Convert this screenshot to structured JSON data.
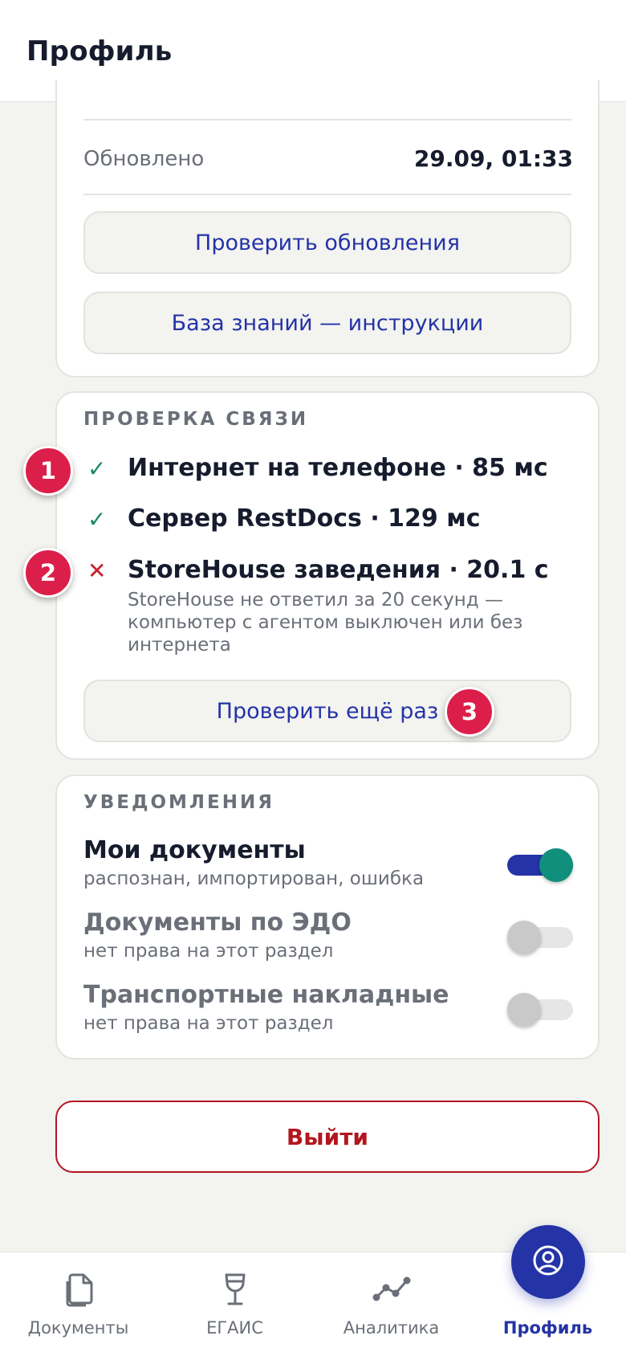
{
  "header": {
    "title": "Профиль"
  },
  "app_info": {
    "updated_label": "Обновлено",
    "updated_value": "29.09, 01:33",
    "check_updates_label": "Проверить обновления",
    "knowledge_base_label": "База знаний — инструкции"
  },
  "connection": {
    "title": "ПРОВЕРКА СВЯЗИ",
    "checks": [
      {
        "status": "ok",
        "mark": "✓",
        "title": "Интернет на телефоне · 85 мс"
      },
      {
        "status": "ok",
        "mark": "✓",
        "title": "Сервер RestDocs · 129 мс"
      },
      {
        "status": "fail",
        "mark": "✕",
        "title": "StoreHouse заведения · 20.1 с",
        "description": "StoreHouse не ответил за 20 секунд — компьютер с агентом выключен или без интернета"
      }
    ],
    "retry_label": "Проверить ещё раз"
  },
  "notifications": {
    "title": "УВЕДОМЛЕНИЯ",
    "items": [
      {
        "title": "Мои документы",
        "subtitle": "распознан, импортирован, ошибка",
        "enabled": true
      },
      {
        "title": "Документы по ЭДО",
        "subtitle": "нет права на этот раздел",
        "enabled": false
      },
      {
        "title": "Транспортные накладные",
        "subtitle": "нет права на этот раздел",
        "enabled": false
      }
    ]
  },
  "logout_label": "Выйти",
  "badges": [
    "1",
    "2",
    "3"
  ],
  "bottom_nav": {
    "items": [
      {
        "label": "Документы",
        "icon": "documents-icon",
        "active": false
      },
      {
        "label": "ЕГАИС",
        "icon": "wine-glass-icon",
        "active": false
      },
      {
        "label": "Аналитика",
        "icon": "analytics-icon",
        "active": false
      },
      {
        "label": "Профиль",
        "icon": "profile-icon",
        "active": true
      }
    ]
  },
  "colors": {
    "accent": "#2433a6",
    "success": "#1a8a5a",
    "danger": "#b3161f",
    "badge": "#dc1f4a",
    "toggle_knob_on": "#108f7c",
    "background": "#f3f3f0"
  }
}
